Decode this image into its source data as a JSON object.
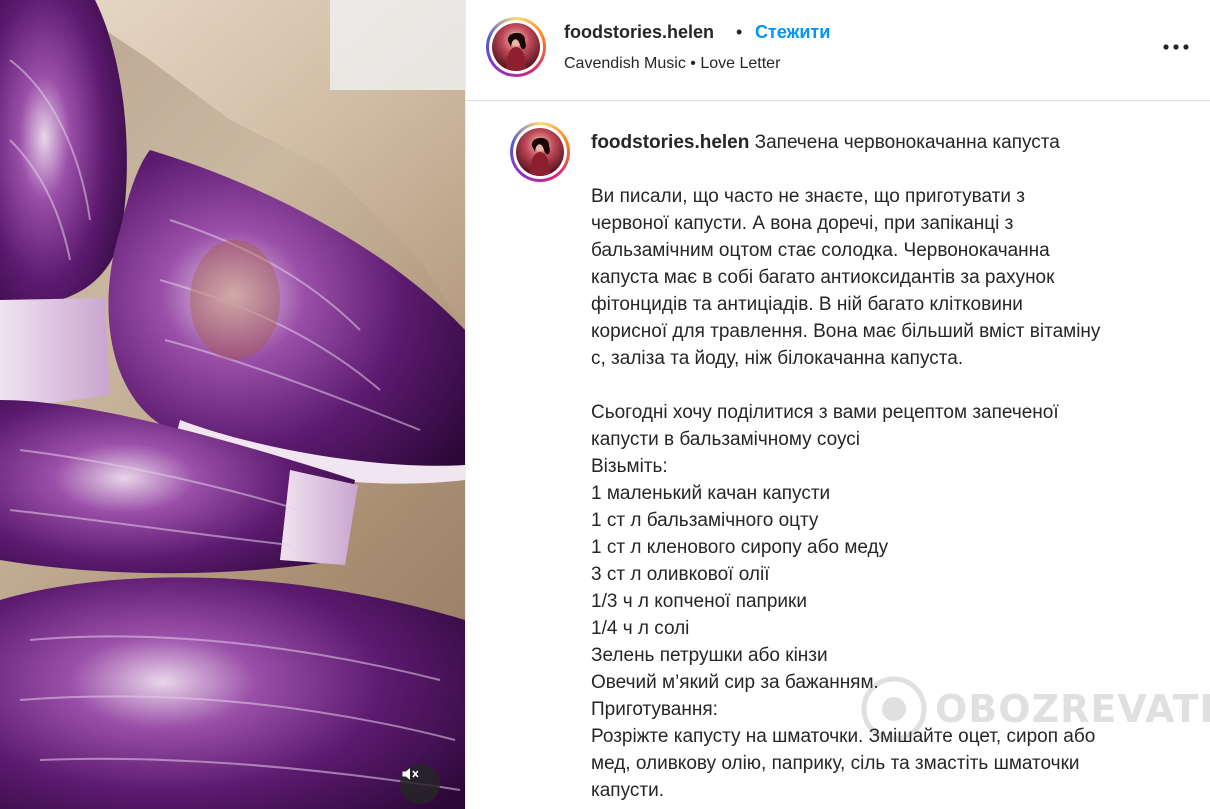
{
  "header": {
    "username": "foodstories.helen",
    "separator": "•",
    "follow_label": "Стежити",
    "audio_artist": "Cavendish Music",
    "audio_separator": "•",
    "audio_track": "Love Letter"
  },
  "caption": {
    "username": "foodstories.helen",
    "title": "Запечена червонокачанна капуста",
    "intro_lines": [
      "Ви писали, що часто не знаєте, що приготувати з",
      "червоної капусти. А вона доречі, при запіканці з",
      "бальзамічним оцтом стає солодка. Червонокачанна",
      "капуста має в собі багато антиоксидантів за рахунок",
      "фітонцидів та антиціадів. В ній багато клітковини",
      "корисної для травлення. Вона має більший вміст вітаміну",
      "с, заліза та йоду, ніж білокачанна капуста."
    ],
    "recipe_lines": [
      "Сьогодні хочу поділитися з вами рецептом запеченої",
      "капусти в бальзамічному соусі",
      "Візьміть:",
      "1 маленький качан капусти",
      "1 ст л бальзамічного оцту",
      "1 ст л кленового сиропу або меду",
      "3 ст л оливкової олії",
      "1/3 ч л копченої паприки",
      "1/4 ч л солі",
      "Зелень петрушки або кінзи",
      "Овечий м’який сир за бажанням.",
      "Приготування:",
      "Розріжте капусту на шматочки. Змішайте оцет, сироп або",
      "мед, оливкову олію, паприку, сіль та змастіть шматочки",
      "капусти."
    ]
  },
  "watermark": {
    "text": "OBOZREVATEL"
  },
  "icons": {
    "more": "more-horizontal-icon",
    "mute": "speaker-muted-icon"
  },
  "colors": {
    "follow": "#0095f6",
    "text": "#262626",
    "cabbage": "#5b1a6e"
  }
}
